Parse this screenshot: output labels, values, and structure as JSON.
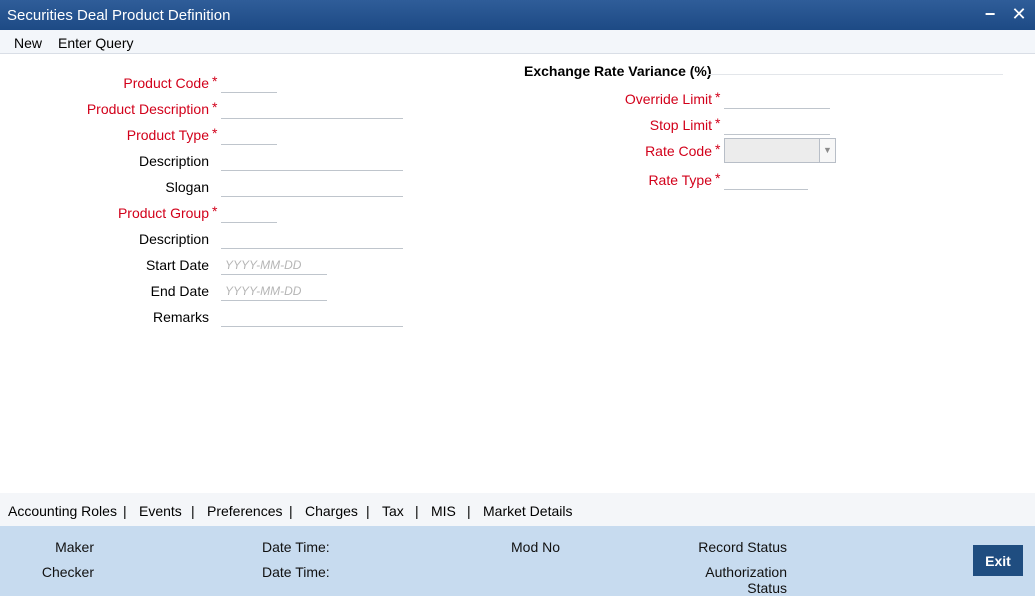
{
  "window": {
    "title": "Securities Deal Product Definition",
    "minimize_label": "−",
    "close_label": "✕"
  },
  "menu": {
    "new_label": "New",
    "enter_query_label": "Enter Query"
  },
  "form_left": {
    "product_code": {
      "label": "Product Code",
      "required": true,
      "value": ""
    },
    "product_description": {
      "label": "Product Description",
      "required": true,
      "value": ""
    },
    "product_type": {
      "label": "Product Type",
      "required": true,
      "value": ""
    },
    "description": {
      "label": "Description",
      "value": ""
    },
    "slogan": {
      "label": "Slogan",
      "value": ""
    },
    "product_group": {
      "label": "Product Group",
      "required": true,
      "value": ""
    },
    "group_description": {
      "label": "Description",
      "value": ""
    },
    "start_date": {
      "label": "Start Date",
      "placeholder": "YYYY-MM-DD",
      "value": ""
    },
    "end_date": {
      "label": "End Date",
      "placeholder": "YYYY-MM-DD",
      "value": ""
    },
    "remarks": {
      "label": "Remarks",
      "value": ""
    }
  },
  "exchange_rate": {
    "section_title": "Exchange Rate Variance (%)",
    "override_limit": {
      "label": "Override Limit",
      "required": true,
      "value": ""
    },
    "stop_limit": {
      "label": "Stop Limit",
      "required": true,
      "value": ""
    },
    "rate_code": {
      "label": "Rate Code",
      "required": true,
      "value": ""
    },
    "rate_type": {
      "label": "Rate Type",
      "required": true,
      "value": ""
    }
  },
  "required_marker": "*",
  "tabs": [
    "Accounting Roles",
    "Events",
    "Preferences",
    "Charges",
    "Tax",
    "MIS",
    "Market Details"
  ],
  "tab_separator": "|",
  "footer": {
    "maker_label": "Maker",
    "checker_label": "Checker",
    "date_time_label_1": "Date Time:",
    "date_time_label_2": "Date Time:",
    "mod_no_label": "Mod No",
    "record_status_label": "Record Status",
    "authorization_status_line1": "Authorization",
    "authorization_status_line2": "Status",
    "exit_label": "Exit"
  },
  "colors": {
    "title_bar": "#1d4a85",
    "required_label": "#d2001a",
    "footer_bg": "#c7dbef",
    "exit_button": "#1f4d80"
  }
}
